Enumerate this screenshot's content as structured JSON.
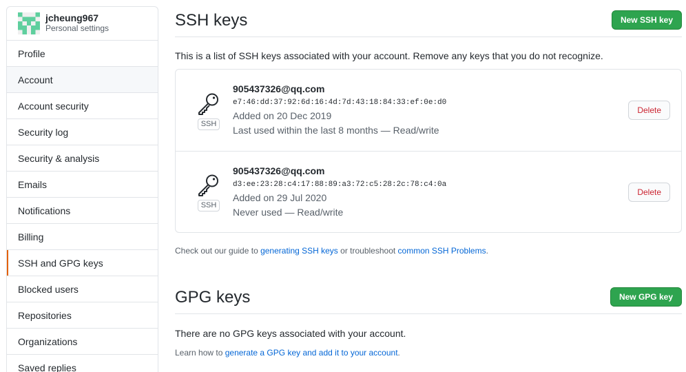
{
  "profile": {
    "username": "jcheung967",
    "subtitle": "Personal settings",
    "avatar_color": "#5fcf9e"
  },
  "sidebar": {
    "items": [
      {
        "label": "Profile"
      },
      {
        "label": "Account"
      },
      {
        "label": "Account security"
      },
      {
        "label": "Security log"
      },
      {
        "label": "Security & analysis"
      },
      {
        "label": "Emails"
      },
      {
        "label": "Notifications"
      },
      {
        "label": "Billing"
      },
      {
        "label": "SSH and GPG keys"
      },
      {
        "label": "Blocked users"
      },
      {
        "label": "Repositories"
      },
      {
        "label": "Organizations"
      },
      {
        "label": "Saved replies"
      }
    ],
    "hovered": "Account",
    "selected": "SSH and GPG keys",
    "selected_accent": "#e36209"
  },
  "ssh": {
    "title": "SSH keys",
    "new_button": "New SSH key",
    "intro": "This is a list of SSH keys associated with your account. Remove any keys that you do not recognize.",
    "keys": [
      {
        "title": "905437326@qq.com",
        "fingerprint": "e7:46:dd:37:92:6d:16:4d:7d:43:18:84:33:ef:0e:d0",
        "added": "Added on 20 Dec 2019",
        "usage": "Last used within the last 8 months — Read/write",
        "badge": "SSH",
        "delete_label": "Delete",
        "icon": "key-icon"
      },
      {
        "title": "905437326@qq.com",
        "fingerprint": "d3:ee:23:28:c4:17:88:89:a3:72:c5:28:2c:78:c4:0a",
        "added": "Added on 29 Jul 2020",
        "usage": "Never used — Read/write",
        "badge": "SSH",
        "delete_label": "Delete",
        "icon": "key-icon"
      }
    ],
    "guide": {
      "prefix": "Check out our guide to ",
      "link1": "generating SSH keys",
      "middle": " or troubleshoot ",
      "link2": "common SSH Problems",
      "suffix": "."
    }
  },
  "gpg": {
    "title": "GPG keys",
    "new_button": "New GPG key",
    "empty": "There are no GPG keys associated with your account.",
    "learn": {
      "prefix": "Learn how to ",
      "link": "generate a GPG key and add it to your account",
      "suffix": "."
    }
  },
  "colors": {
    "primary_button": "#2ea44f",
    "danger_text": "#cb2431",
    "link": "#0366d6"
  }
}
